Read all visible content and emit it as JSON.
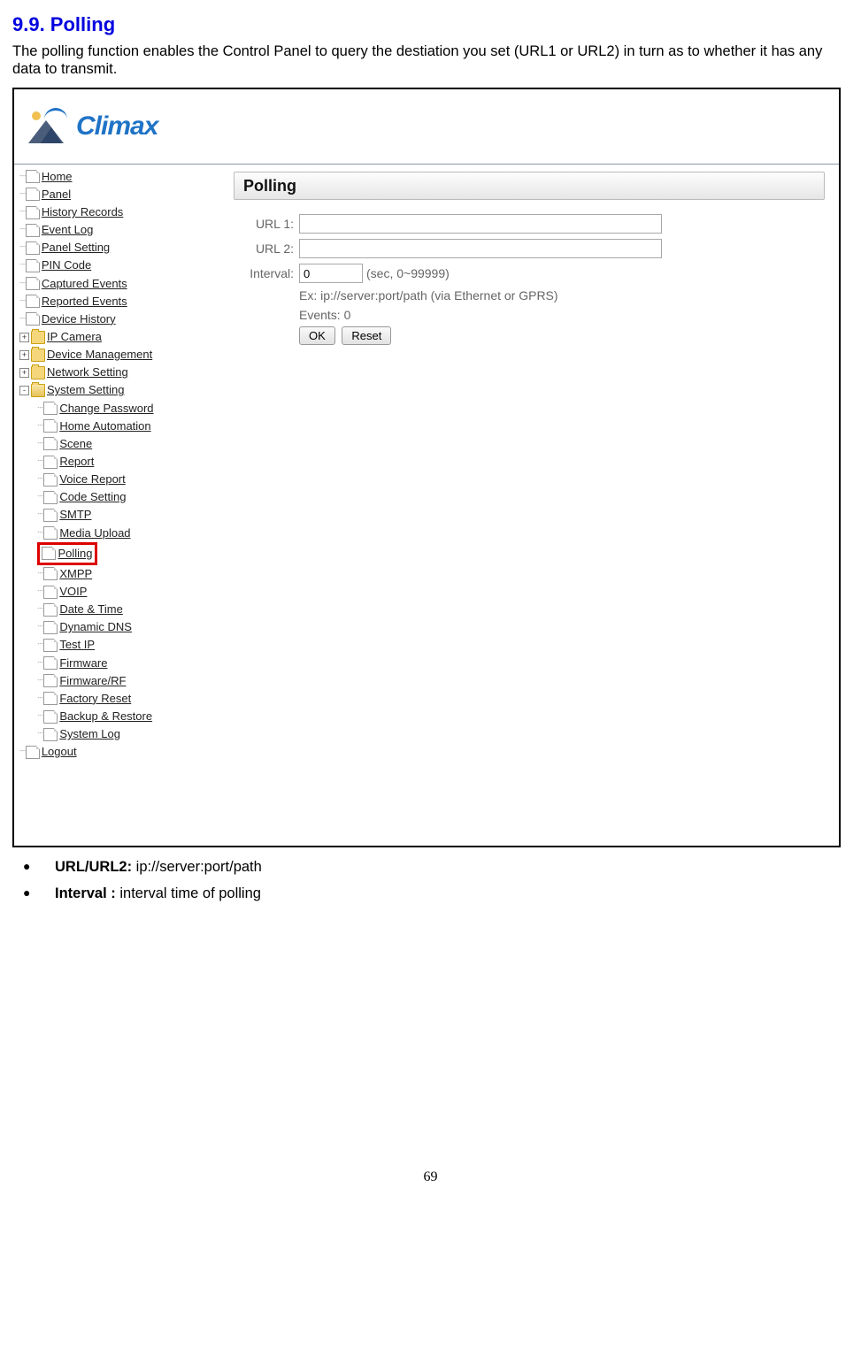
{
  "section": {
    "title": "9.9. Polling"
  },
  "intro": "The polling function enables the Control Panel to query the destiation you set (URL1 or URL2) in turn as to whether it has any data to transmit.",
  "logo_text": "Climax",
  "nav": {
    "items": [
      "Home",
      "Panel",
      "History Records",
      "Event Log",
      "Panel Setting",
      "PIN Code",
      "Captured Events",
      "Reported Events",
      "Device History"
    ],
    "folders": [
      "IP Camera",
      "Device Management",
      "Network Setting"
    ],
    "system_label": "System Setting",
    "system_children": [
      "Change Password",
      "Home Automation",
      "Scene",
      "Report",
      "Voice Report",
      "Code Setting",
      "SMTP",
      "Media Upload",
      "Polling",
      "XMPP",
      "VOIP",
      "Date & Time",
      "Dynamic DNS",
      "Test IP",
      "Firmware",
      "Firmware/RF",
      "Factory Reset",
      "Backup & Restore",
      "System Log"
    ],
    "logout": "Logout"
  },
  "panel": {
    "title": "Polling",
    "url1_label": "URL 1:",
    "url2_label": "URL 2:",
    "interval_label": "Interval:",
    "interval_value": "0",
    "interval_hint": "(sec, 0~99999)",
    "example": "Ex: ip://server:port/path (via Ethernet or GPRS)",
    "events": "Events: 0",
    "ok": "OK",
    "reset": "Reset"
  },
  "bullets": {
    "b1_label": "URL/URL2:",
    "b1_text": " ip://server:port/path",
    "b2_label": "Interval :",
    "b2_text": " interval time of polling"
  },
  "page_number": "69"
}
